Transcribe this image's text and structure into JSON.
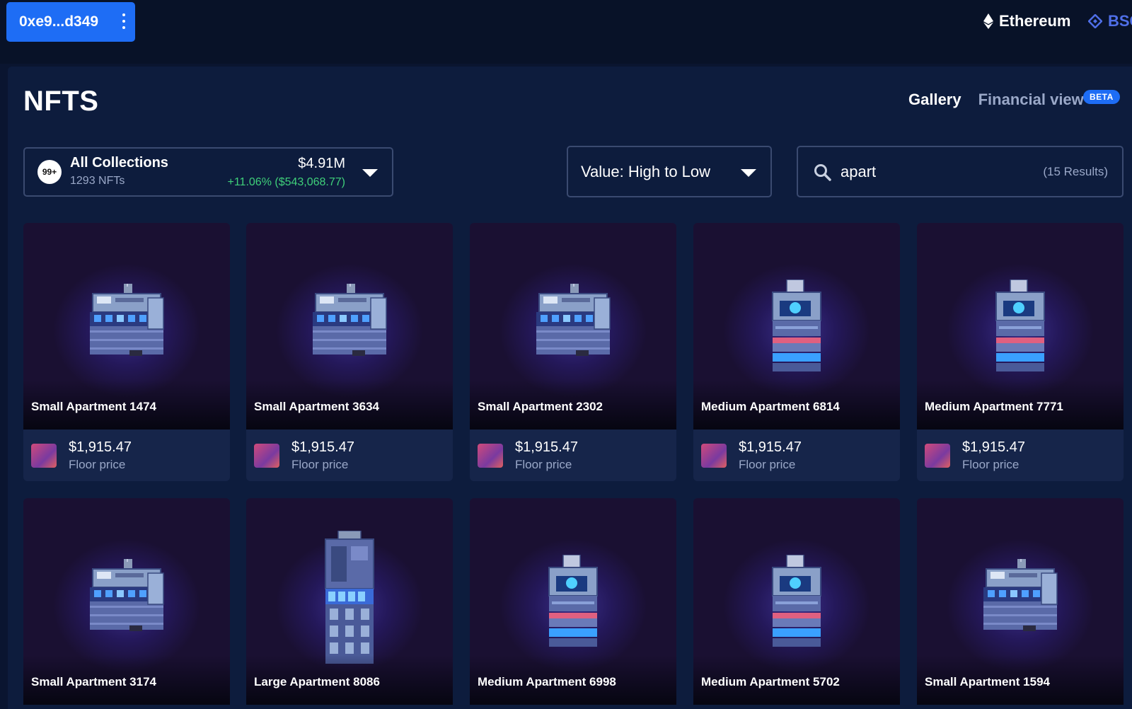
{
  "header": {
    "wallet_label": "0xe9...d349",
    "chains": [
      {
        "label": "Ethereum",
        "color": "#ffffff"
      },
      {
        "label": "BSC",
        "color": "#4f6fe8"
      }
    ]
  },
  "page": {
    "title": "NFTS",
    "tabs": [
      {
        "label": "Gallery",
        "active": true
      },
      {
        "label": "Financial view",
        "active": false
      }
    ],
    "beta_badge": "BETA"
  },
  "collections": {
    "badge": "99+",
    "name": "All Collections",
    "count": "1293 NFTs",
    "value": "$4.91M",
    "change": "+11.06% ($543,068.77)"
  },
  "sort": {
    "label": "Value: High to Low"
  },
  "search": {
    "value": "apart",
    "results": "(15 Results)"
  },
  "cards": [
    {
      "name": "Small Apartment 1474",
      "price": "$1,915.47",
      "price_label": "Floor price",
      "icon": "small-apartment-image"
    },
    {
      "name": "Small Apartment 3634",
      "price": "$1,915.47",
      "price_label": "Floor price",
      "icon": "small-apartment-image"
    },
    {
      "name": "Small Apartment 2302",
      "price": "$1,915.47",
      "price_label": "Floor price",
      "icon": "small-apartment-image"
    },
    {
      "name": "Medium Apartment 6814",
      "price": "$1,915.47",
      "price_label": "Floor price",
      "icon": "medium-apartment-image"
    },
    {
      "name": "Medium Apartment 7771",
      "price": "$1,915.47",
      "price_label": "Floor price",
      "icon": "medium-apartment-image"
    },
    {
      "name": "Small Apartment 3174",
      "icon": "small-apartment-image"
    },
    {
      "name": "Large Apartment 8086",
      "icon": "large-apartment-image"
    },
    {
      "name": "Medium Apartment 6998",
      "icon": "medium-apartment-image"
    },
    {
      "name": "Medium Apartment 5702",
      "icon": "medium-apartment-image"
    },
    {
      "name": "Small Apartment 1594",
      "icon": "small-apartment-image"
    }
  ]
}
